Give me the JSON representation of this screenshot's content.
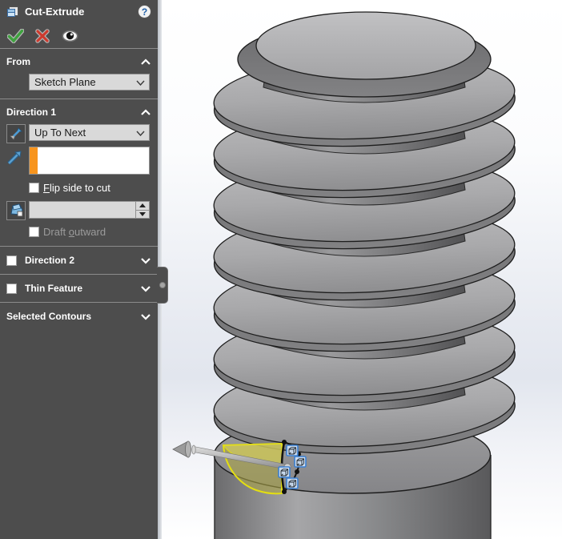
{
  "colors": {
    "panel-bg": "#4d4d4d",
    "panel-text": "#ffffff",
    "disabled-text": "#9b9b9b",
    "separator": "#8b8b8b",
    "control-bg": "#d9d9d9",
    "control-border": "#919191",
    "control-text": "#1a1a1a",
    "active-field": "#f7941d",
    "accent-blue": "#3b7fd0",
    "ok-green": "#3fa23f",
    "cancel-red": "#cd3a2e",
    "preview-yellow": "#e3de12"
  },
  "property_manager": {
    "title": "Cut-Extrude",
    "help_glyph": "?",
    "from": {
      "label": "From",
      "plane": "Sketch Plane"
    },
    "direction1": {
      "label": "Direction 1",
      "end_condition": "Up To Next",
      "selection_value": "",
      "flip": {
        "key": "F",
        "rest": "lip side to cut",
        "checked": false
      },
      "draft_value": "",
      "draft_outward": {
        "pre": "Draft ",
        "key": "o",
        "rest": "utward",
        "checked": false,
        "enabled": false
      }
    },
    "direction2": {
      "label": "Direction 2",
      "checked": false
    },
    "thin_feature": {
      "label": "Thin Feature",
      "checked": false
    },
    "selected_contours": {
      "label": "Selected Contours"
    }
  }
}
